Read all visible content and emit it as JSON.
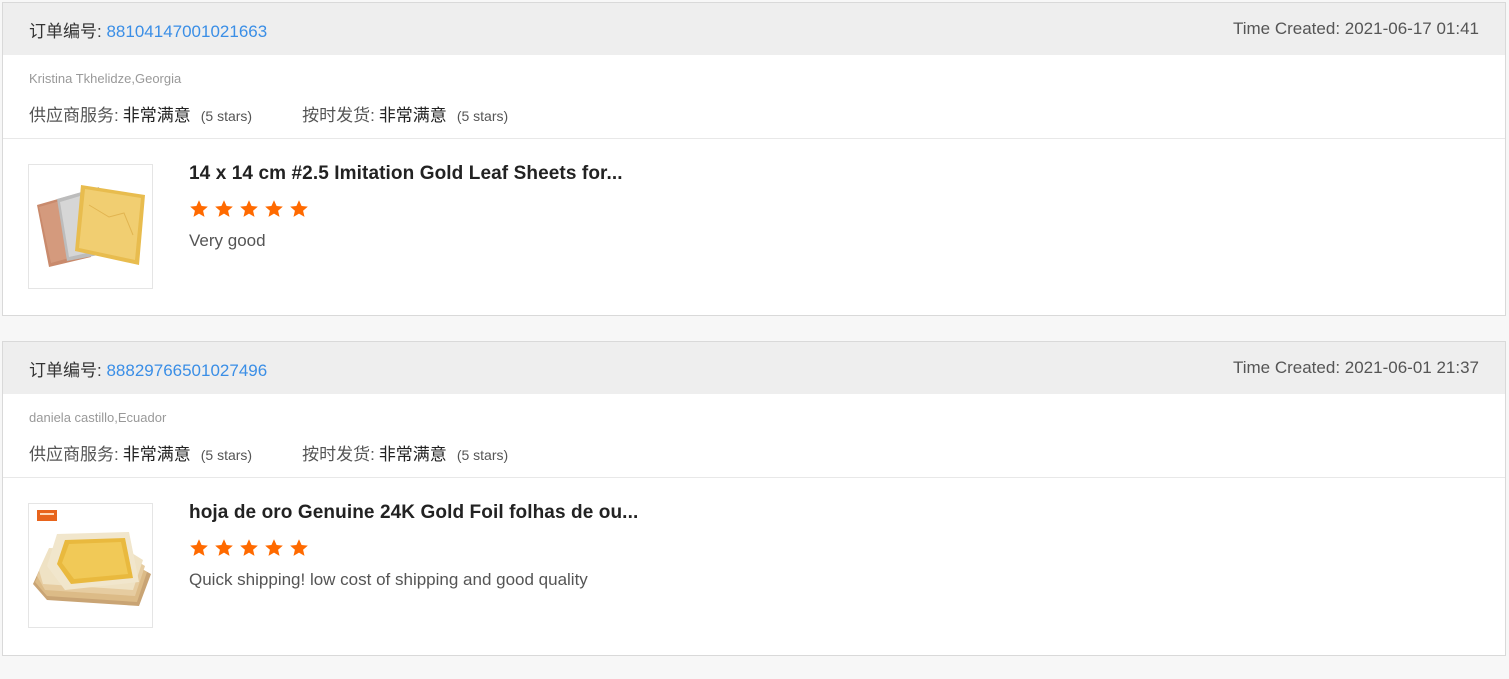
{
  "orders": [
    {
      "order_label": "订单编号:",
      "order_number": "88104147001021663",
      "time_created": "Time Created: 2021-06-17 01:41",
      "buyer": "Kristina Tkhelidze,Georgia",
      "supplier_service_label": "供应商服务:",
      "supplier_service_value": "非常满意",
      "supplier_service_stars": "(5 stars)",
      "on_time_label": "按时发货:",
      "on_time_value": "非常满意",
      "on_time_stars": "(5 stars)",
      "product_title": "14 x 14 cm #2.5 Imitation Gold Leaf Sheets for...",
      "rating": 5,
      "review_text": "Very good",
      "thumbnail_icon": "gold-leaf-sheets-image"
    },
    {
      "order_label": "订单编号:",
      "order_number": "88829766501027496",
      "time_created": "Time Created: 2021-06-01 21:37",
      "buyer": "daniela castillo,Ecuador",
      "supplier_service_label": "供应商服务:",
      "supplier_service_value": "非常满意",
      "supplier_service_stars": "(5 stars)",
      "on_time_label": "按时发货:",
      "on_time_value": "非常满意",
      "on_time_stars": "(5 stars)",
      "product_title": "hoja de oro Genuine 24K Gold Foil folhas de ou...",
      "rating": 5,
      "review_text": "Quick shipping! low cost of shipping and good quality",
      "thumbnail_icon": "gold-foil-stack-image"
    }
  ],
  "colors": {
    "link": "#3a8ee6",
    "star": "#ff6a00",
    "header_bg": "#eeeeee"
  }
}
